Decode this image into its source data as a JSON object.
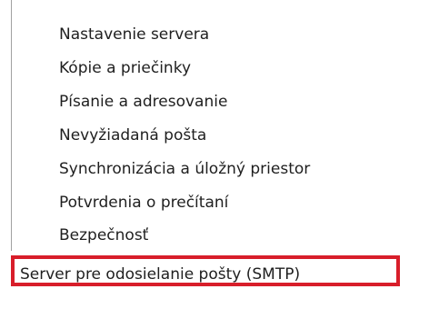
{
  "tree": {
    "items": [
      {
        "label": "Nastavenie servera"
      },
      {
        "label": "Kópie a priečinky"
      },
      {
        "label": "Písanie a adresovanie"
      },
      {
        "label": "Nevyžiadaná pošta"
      },
      {
        "label": "Synchronizácia a úložný priestor"
      },
      {
        "label": "Potvrdenia o prečítaní"
      },
      {
        "label": "Bezpečnosť"
      },
      {
        "label": "Server pre odosielanie pošty (SMTP)"
      }
    ],
    "selected_index": 7,
    "highlight_color": "#d81e2a"
  }
}
